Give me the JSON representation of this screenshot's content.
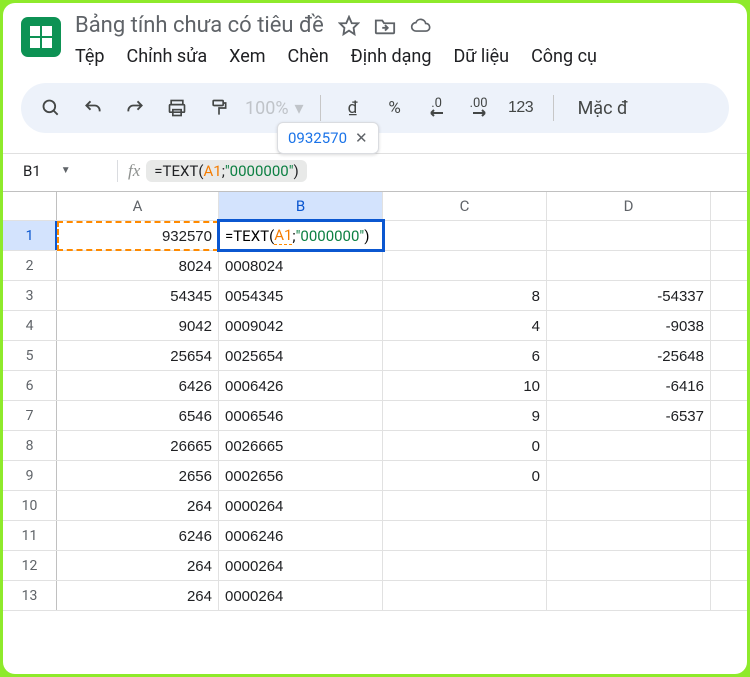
{
  "header": {
    "doc_title": "Bảng tính chưa có tiêu đề",
    "menu": {
      "file": "Tệp",
      "edit": "Chỉnh sửa",
      "view": "Xem",
      "insert": "Chèn",
      "format": "Định dạng",
      "data": "Dữ liệu",
      "tools": "Công cụ"
    }
  },
  "toolbar": {
    "zoom": "100%",
    "currency_symbol": "₫",
    "percent_symbol": "%",
    "dec_dec": ".0",
    "dec_inc": ".00",
    "more_formats": "123",
    "default_label": "Mặc đ"
  },
  "popover": {
    "value": "0932570"
  },
  "name_box": {
    "cell": "B1"
  },
  "formula_bar": {
    "prefix": "=TEXT(",
    "ref": "A1",
    "mid": ";",
    "str": "\"0000000\"",
    "suffix": ")"
  },
  "columns": {
    "A": "A",
    "B": "B",
    "C": "C",
    "D": "D"
  },
  "active_cell_edit": {
    "prefix": "=TEXT(",
    "ref": "A1",
    "mid": ";",
    "str": "\"0000000\"",
    "suffix": ")"
  },
  "rows": [
    {
      "n": "1",
      "A": "932570",
      "B": "",
      "C": "",
      "D": ""
    },
    {
      "n": "2",
      "A": "8024",
      "B": "0008024",
      "C": "",
      "D": ""
    },
    {
      "n": "3",
      "A": "54345",
      "B": "0054345",
      "C": "8",
      "D": "-54337"
    },
    {
      "n": "4",
      "A": "9042",
      "B": "0009042",
      "C": "4",
      "D": "-9038"
    },
    {
      "n": "5",
      "A": "25654",
      "B": "0025654",
      "C": "6",
      "D": "-25648"
    },
    {
      "n": "6",
      "A": "6426",
      "B": "0006426",
      "C": "10",
      "D": "-6416"
    },
    {
      "n": "7",
      "A": "6546",
      "B": "0006546",
      "C": "9",
      "D": "-6537"
    },
    {
      "n": "8",
      "A": "26665",
      "B": "0026665",
      "C": "0",
      "D": ""
    },
    {
      "n": "9",
      "A": "2656",
      "B": "0002656",
      "C": "0",
      "D": ""
    },
    {
      "n": "10",
      "A": "264",
      "B": "0000264",
      "C": "",
      "D": ""
    },
    {
      "n": "11",
      "A": "6246",
      "B": "0006246",
      "C": "",
      "D": ""
    },
    {
      "n": "12",
      "A": "264",
      "B": "0000264",
      "C": "",
      "D": ""
    },
    {
      "n": "13",
      "A": "264",
      "B": "0000264",
      "C": "",
      "D": ""
    }
  ]
}
